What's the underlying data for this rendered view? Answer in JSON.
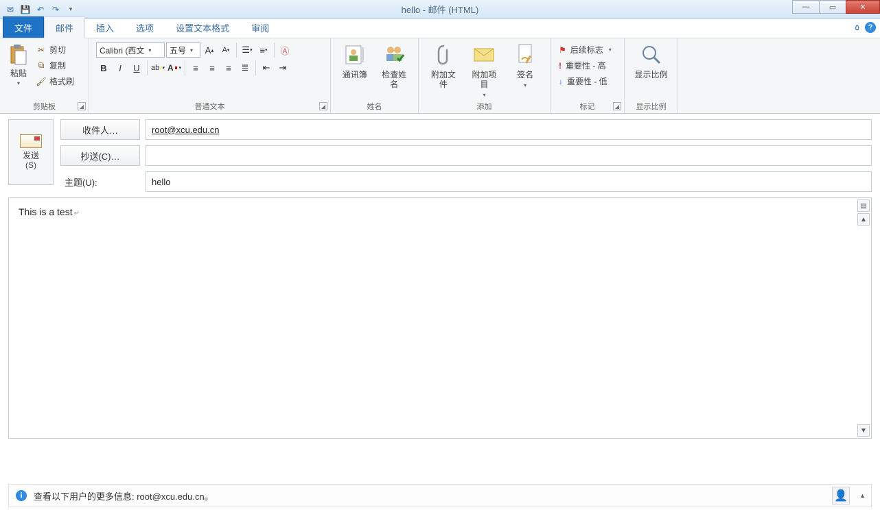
{
  "window": {
    "title": "hello - 邮件 (HTML)"
  },
  "tabs": {
    "file": "文件",
    "mail": "邮件",
    "insert": "插入",
    "options": "选项",
    "format": "设置文本格式",
    "review": "审阅"
  },
  "ribbon": {
    "clipboard": {
      "label": "剪贴板",
      "paste": "粘贴",
      "cut": "剪切",
      "copy": "复制",
      "painter": "格式刷"
    },
    "basictext": {
      "label": "普通文本",
      "font": "Calibri (西文",
      "size": "五号"
    },
    "names": {
      "label": "姓名",
      "addressbook": "通讯簿",
      "checknames": "检查姓名"
    },
    "include": {
      "label": "添加",
      "attachfile": "附加文件",
      "attachitem": "附加项目",
      "signature": "签名"
    },
    "tags": {
      "label": "标记",
      "followup": "后续标志",
      "high": "重要性 - 高",
      "low": "重要性 - 低"
    },
    "zoom": {
      "label": "显示比例",
      "btn": "显示比例"
    }
  },
  "compose": {
    "send": "发送",
    "send_key": "(S)",
    "to_btn": "收件人…",
    "cc_btn": "抄送(C)…",
    "subject_label": "主题(U):",
    "to_value": "root@xcu.edu.cn",
    "cc_value": "",
    "subject_value": "hello",
    "body": "This is a test"
  },
  "infobar": {
    "text": "查看以下用户的更多信息: root@xcu.edu.cn。"
  }
}
